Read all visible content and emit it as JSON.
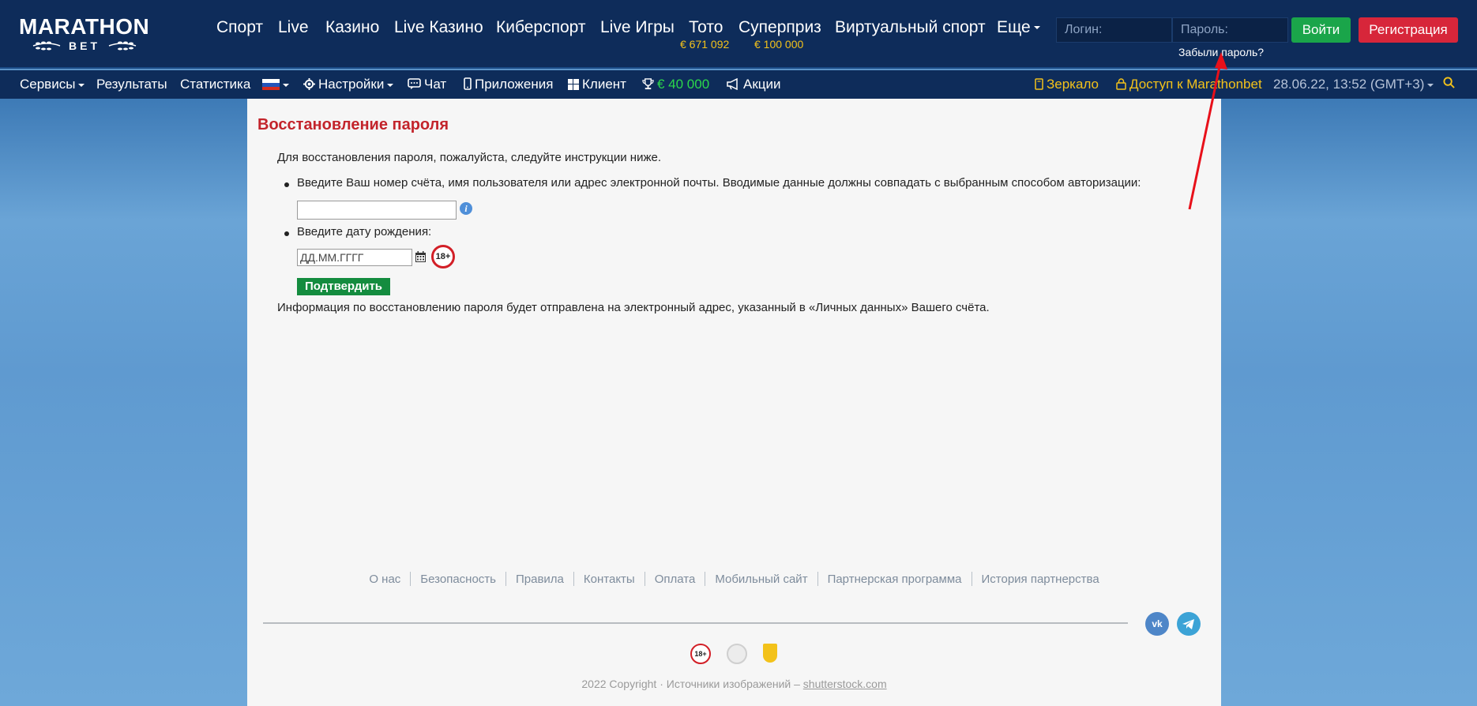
{
  "brand": {
    "name": "MARATHON",
    "sub": "BET"
  },
  "mainnav": {
    "items": [
      {
        "label": "Спорт",
        "sub": ""
      },
      {
        "label": "Live",
        "sub": ""
      },
      {
        "label": "Казино",
        "sub": ""
      },
      {
        "label": "Live Казино",
        "sub": ""
      },
      {
        "label": "Киберспорт",
        "sub": ""
      },
      {
        "label": "Live Игры",
        "sub": ""
      },
      {
        "label": "Тото",
        "sub": "€ 671 092"
      },
      {
        "label": "Суперприз",
        "sub": "€ 100 000"
      },
      {
        "label": "Виртуальный спорт",
        "sub": ""
      },
      {
        "label": "Еще",
        "sub": ""
      }
    ]
  },
  "auth": {
    "login_placeholder": "Логин:",
    "password_placeholder": "Пароль:",
    "login_button": "Войти",
    "register_button": "Регистрация",
    "forgot_link": "Забыли пароль?"
  },
  "subnav": {
    "services": "Сервисы",
    "results": "Результаты",
    "stats": "Статистика",
    "settings": "Настройки",
    "chat": "Чат",
    "apps": "Приложения",
    "client": "Клиент",
    "jackpot": "€ 40 000",
    "promos": "Акции",
    "mirror": "Зеркало",
    "access": "Доступ к Marathonbet",
    "datetime": "28.06.22, 13:52 (GMT+3)"
  },
  "content": {
    "title": "Восстановление пароля",
    "intro": "Для восстановления пароля, пожалуйста, следуйте инструкции ниже.",
    "step1": "Введите Ваш номер счёта, имя пользователя или адрес электронной почты. Вводимые данные должны совпадать с выбранным способом авторизации:",
    "account_value": "",
    "step2": "Введите дату рождения:",
    "date_placeholder": "ДД.ММ.ГГГГ",
    "age_badge": "18+",
    "confirm_button": "Подтвердить",
    "note": "Информация по восстановлению пароля будет отправлена на электронный адрес, указанный в «Личных данных» Вашего счёта."
  },
  "footer": {
    "links": [
      "О нас",
      "Безопасность",
      "Правила",
      "Контакты",
      "Оплата",
      "Мобильный сайт",
      "Партнерская программа",
      "История партнерства"
    ],
    "vk": "vk",
    "age": "18+",
    "copyright": "2022 Copyright · Источники изображений – ",
    "copyright_link": "shutterstock.com"
  },
  "colors": {
    "header": "#0e2c5a",
    "accent_green": "#1aa54a",
    "accent_red": "#d7263a",
    "title_red": "#c3242b",
    "yellow": "#f3c21a"
  }
}
